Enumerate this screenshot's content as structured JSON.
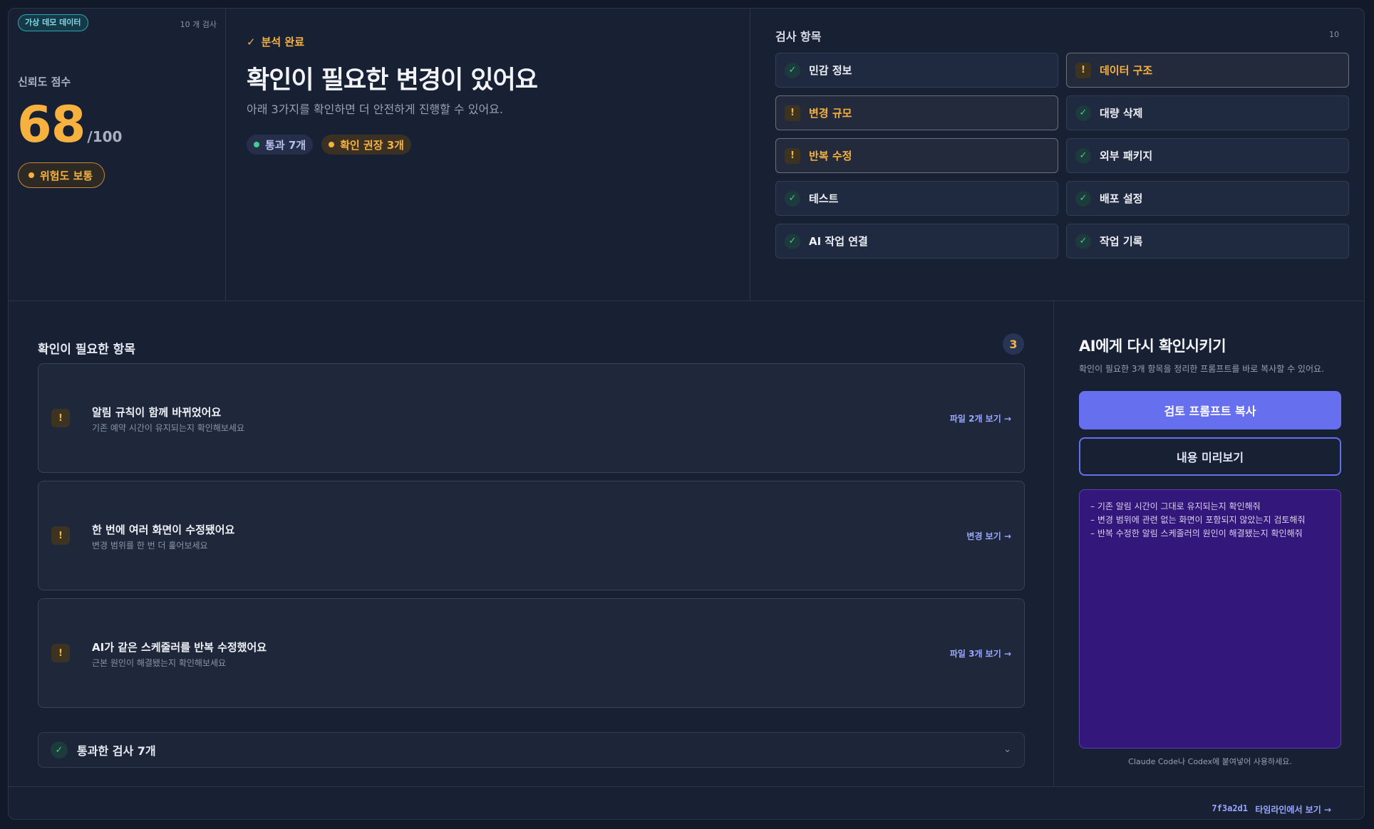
{
  "score_panel": {
    "demo_badge": "가상 데모 데이터",
    "check_count": "10 개 검사",
    "label": "신뢰도 점수",
    "score": "68",
    "max": "/100",
    "risk": "위험도 보통",
    "risk_color": "#f6b13f"
  },
  "summary": {
    "status_icon": "✓",
    "status": "분석 완료",
    "headline": "확인이 필요한 변경이 있어요",
    "subline": "아래 3가지를 확인하면 더 안전하게 진행할 수 있어요.",
    "pass_pill": "통과 7개",
    "warn_pill": "확인 권장 3개"
  },
  "checks": {
    "title": "검사 항목",
    "count": "10",
    "items": [
      {
        "label": "민감 정보",
        "status": "ok"
      },
      {
        "label": "데이터 구조",
        "status": "warn"
      },
      {
        "label": "변경 규모",
        "status": "warn"
      },
      {
        "label": "대량 삭제",
        "status": "ok"
      },
      {
        "label": "반복 수정",
        "status": "warn"
      },
      {
        "label": "외부 패키지",
        "status": "ok"
      },
      {
        "label": "테스트",
        "status": "ok"
      },
      {
        "label": "배포 설정",
        "status": "ok"
      },
      {
        "label": "AI 작업 연결",
        "status": "ok"
      },
      {
        "label": "작업 기록",
        "status": "ok"
      }
    ]
  },
  "issues": {
    "title": "확인이 필요한 항목",
    "count": "3",
    "items": [
      {
        "title": "알림 규칙이 함께 바뀌었어요",
        "desc": "기존 예약 시간이 유지되는지 확인해보세요",
        "link": "파일 2개 보기 →"
      },
      {
        "title": "한 번에 여러 화면이 수정됐어요",
        "desc": "변경 범위를 한 번 더 훑어보세요",
        "link": "변경 보기 →"
      },
      {
        "title": "AI가 같은 스케줄러를 반복 수정했어요",
        "desc": "근본 원인이 해결됐는지 확인해보세요",
        "link": "파일 3개 보기 →"
      }
    ],
    "passed_label": "통과한 검사 7개",
    "chevron": "⌄"
  },
  "ai_panel": {
    "title": "AI에게 다시 확인시키기",
    "desc": "확인이 필요한 3개 항목을 정리한 프롬프트를 바로 복사할 수 있어요.",
    "copy_button": "검토 프롬프트 복사",
    "preview_button": "내용 미리보기",
    "preview_lines": [
      "– 기존 알림 시간이 그대로 유지되는지 확인해줘",
      "– 변경 범위에 관련 없는 화면이 포함되지 않았는지 검토해줘",
      "– 반복 수정한 알림 스케줄러의 원인이 해결됐는지 확인해줘"
    ],
    "hint": "Claude Code나 Codex에 붙여넣어 사용하세요."
  },
  "footer": {
    "commit": "7f3a2d1",
    "timeline_link": "타임라인에서 보기 →"
  },
  "colors": {
    "accent": "#6670ee",
    "warning": "#f6b13f",
    "success": "#3ecf8e"
  }
}
